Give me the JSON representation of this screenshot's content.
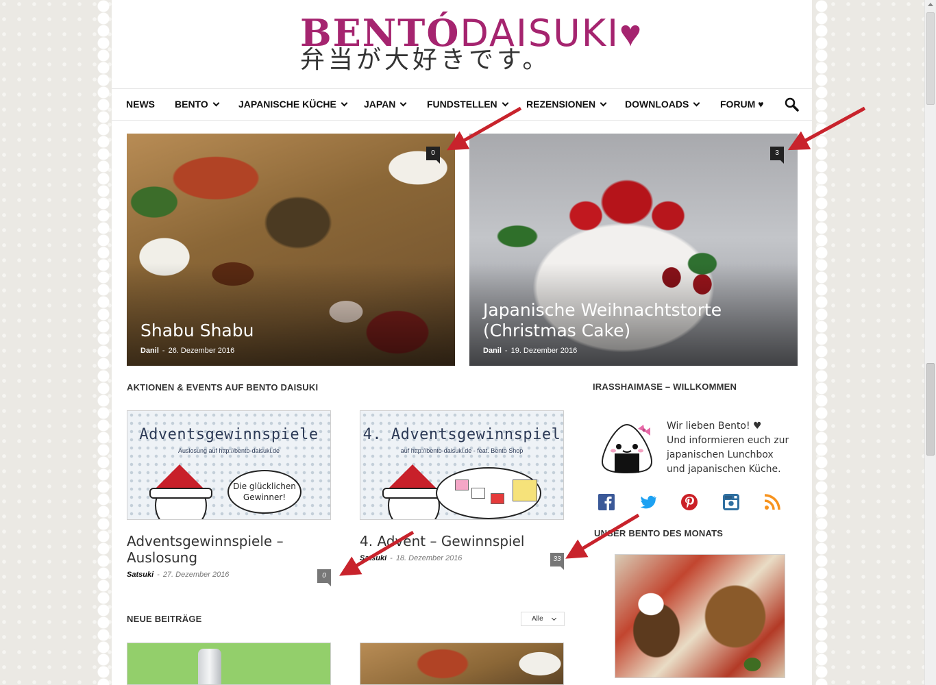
{
  "logo": {
    "brand_bold": "BENTÓ",
    "brand_light": "DAISUKI",
    "heart": "♥",
    "japanese": "弁当が大好きです。"
  },
  "nav": {
    "items": [
      {
        "label": "NEWS"
      },
      {
        "label": "BENTO"
      },
      {
        "label": "JAPANISCHE KÜCHE"
      },
      {
        "label": "JAPAN"
      },
      {
        "label": "FUNDSTELLEN"
      },
      {
        "label": "REZENSIONEN"
      },
      {
        "label": "DOWNLOADS"
      },
      {
        "label": "FORUM ♥"
      }
    ],
    "search_icon": "search-icon"
  },
  "features": [
    {
      "title": "Shabu Shabu",
      "author": "Danil",
      "sep": "-",
      "date": "26. Dezember 2016",
      "comments": "0"
    },
    {
      "title": "Japanische Weihnachtstorte (Christmas Cake)",
      "author": "Danil",
      "sep": "-",
      "date": "19. Dezember 2016",
      "comments": "3"
    }
  ],
  "events": {
    "heading": "AKTIONEN & EVENTS AUF BENTO DAISUKI",
    "cards": [
      {
        "thumb_title": "Adventsgewinnspiele",
        "thumb_sub": "Auslosung auf http://bento-daisuki.de",
        "bubble": "Die glücklichen Gewinner!",
        "title": "Adventsgewinnspiele – Auslosung",
        "author": "Satsuki",
        "sep": "-",
        "date": "27. Dezember 2016",
        "comments": "0"
      },
      {
        "thumb_title": "4. Adventsgewinnspiel",
        "thumb_sub": "auf http://bento-daisuki.de - feat. Bento Shop",
        "title": "4. Advent – Gewinnspiel",
        "author": "Satsuki",
        "sep": "-",
        "date": "18. Dezember 2016",
        "comments": "33"
      }
    ]
  },
  "new_posts": {
    "heading": "NEUE BEITRÄGE",
    "filter": "Alle"
  },
  "sidebar": {
    "welcome_heading": "IRASSHAIMASE – WILLKOMMEN",
    "welcome_lines": [
      "Wir lieben Bento! ♥",
      "Und informieren euch zur",
      "japanischen Lunchbox",
      "und japanischen Küche."
    ],
    "social": [
      "facebook-icon",
      "twitter-icon",
      "pinterest-icon",
      "instagram-icon",
      "rss-icon"
    ],
    "month_heading": "UNSER BENTO DES MONATS"
  },
  "colors": {
    "brand": "#a5246f",
    "arrow": "#c8232c",
    "bubble_dark": "#222222",
    "bubble_grey": "#777777"
  }
}
